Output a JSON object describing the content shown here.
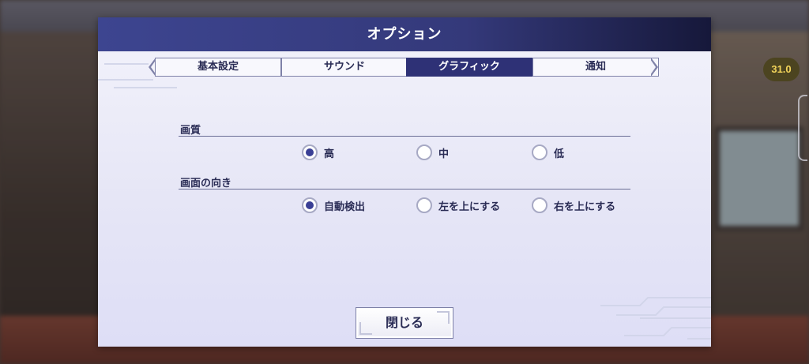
{
  "overlay": {
    "fps_badge": "31.0"
  },
  "dialog": {
    "title": "オプション",
    "tabs": [
      {
        "label": "基本設定",
        "active": false
      },
      {
        "label": "サウンド",
        "active": false
      },
      {
        "label": "グラフィック",
        "active": true
      },
      {
        "label": "通知",
        "active": false
      }
    ],
    "sections": [
      {
        "label": "画質",
        "options": [
          {
            "label": "高",
            "selected": true
          },
          {
            "label": "中",
            "selected": false
          },
          {
            "label": "低",
            "selected": false
          }
        ]
      },
      {
        "label": "画面の向き",
        "options": [
          {
            "label": "自動検出",
            "selected": true
          },
          {
            "label": "左を上にする",
            "selected": false
          },
          {
            "label": "右を上にする",
            "selected": false
          }
        ]
      }
    ],
    "close_label": "閉じる"
  },
  "colors": {
    "accent": "#2e3176",
    "title_bar": "#3d4590",
    "fps_text": "#f2d45a"
  }
}
